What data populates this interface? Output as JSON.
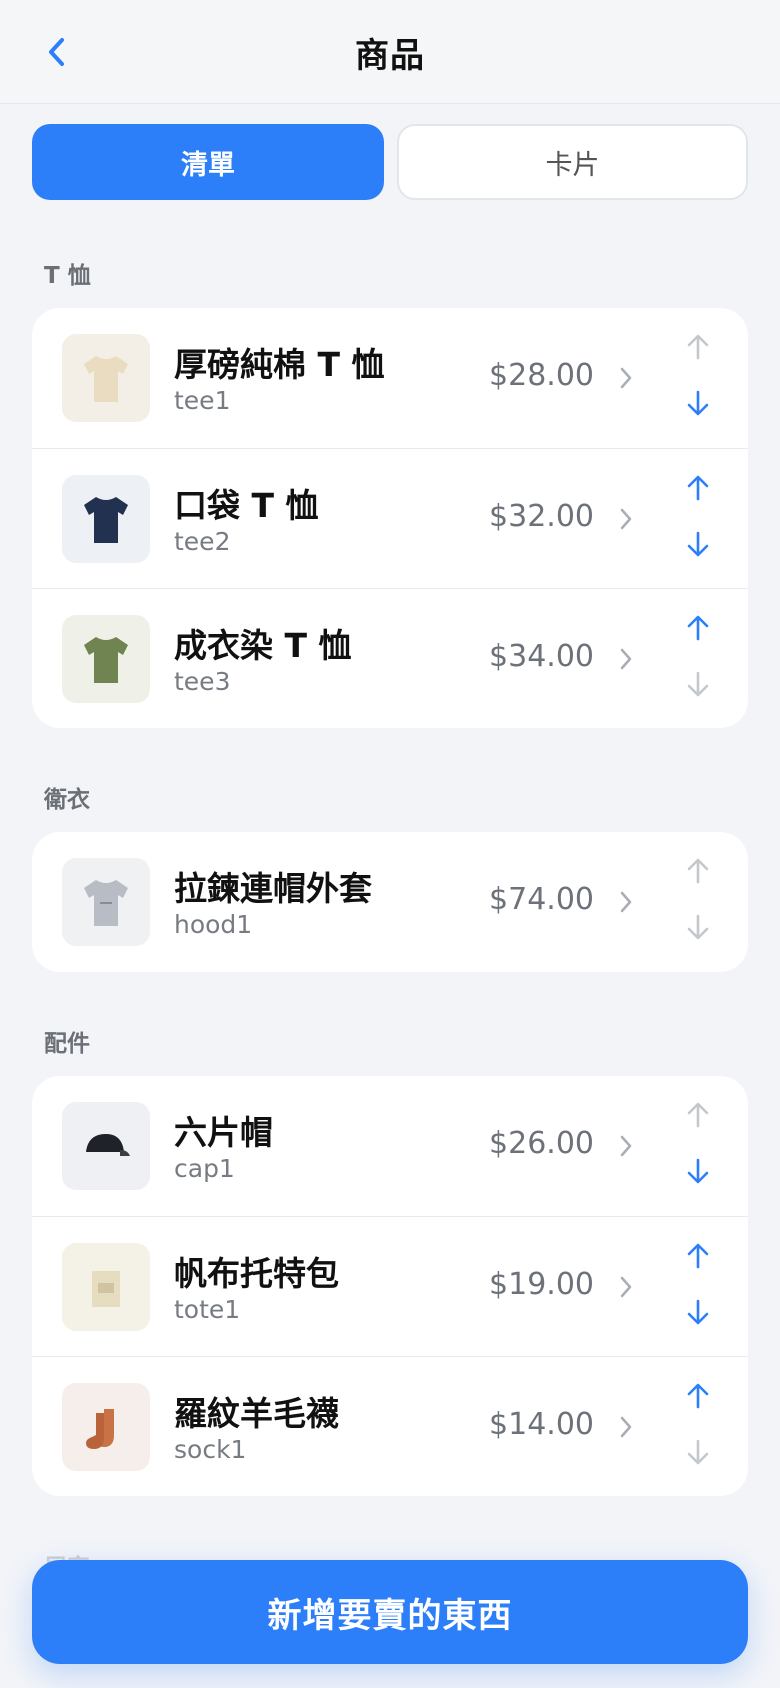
{
  "header": {
    "title": "商品",
    "back_icon": "chevron-left-icon"
  },
  "view_toggle": {
    "list_label": "清單",
    "card_label": "卡片",
    "selected": "清單"
  },
  "colors": {
    "accent": "#2d7ff9",
    "disabled_arrow": "#c4c7cc"
  },
  "sections": [
    {
      "label": "T 恤",
      "items": [
        {
          "name": "厚磅純棉 T 恤",
          "sku": "tee1",
          "price": "$28.00",
          "icon": "tshirt-icon",
          "up_enabled": false,
          "down_enabled": true
        },
        {
          "name": "口袋 T 恤",
          "sku": "tee2",
          "price": "$32.00",
          "icon": "tshirt-icon",
          "up_enabled": true,
          "down_enabled": true
        },
        {
          "name": "成衣染 T 恤",
          "sku": "tee3",
          "price": "$34.00",
          "icon": "tshirt-icon",
          "up_enabled": true,
          "down_enabled": false
        }
      ]
    },
    {
      "label": "衛衣",
      "items": [
        {
          "name": "拉鍊連帽外套",
          "sku": "hood1",
          "price": "$74.00",
          "icon": "hoodie-icon",
          "up_enabled": false,
          "down_enabled": false
        }
      ]
    },
    {
      "label": "配件",
      "items": [
        {
          "name": "六片帽",
          "sku": "cap1",
          "price": "$26.00",
          "icon": "cap-icon",
          "up_enabled": false,
          "down_enabled": true
        },
        {
          "name": "帆布托特包",
          "sku": "tote1",
          "price": "$19.00",
          "icon": "tote-bag-icon",
          "up_enabled": true,
          "down_enabled": true
        },
        {
          "name": "羅紋羊毛襪",
          "sku": "sock1",
          "price": "$14.00",
          "icon": "socks-icon",
          "up_enabled": true,
          "down_enabled": false
        }
      ]
    },
    {
      "label": "居家",
      "items": []
    }
  ],
  "footer": {
    "add_button_label": "新增要賣的東西"
  }
}
